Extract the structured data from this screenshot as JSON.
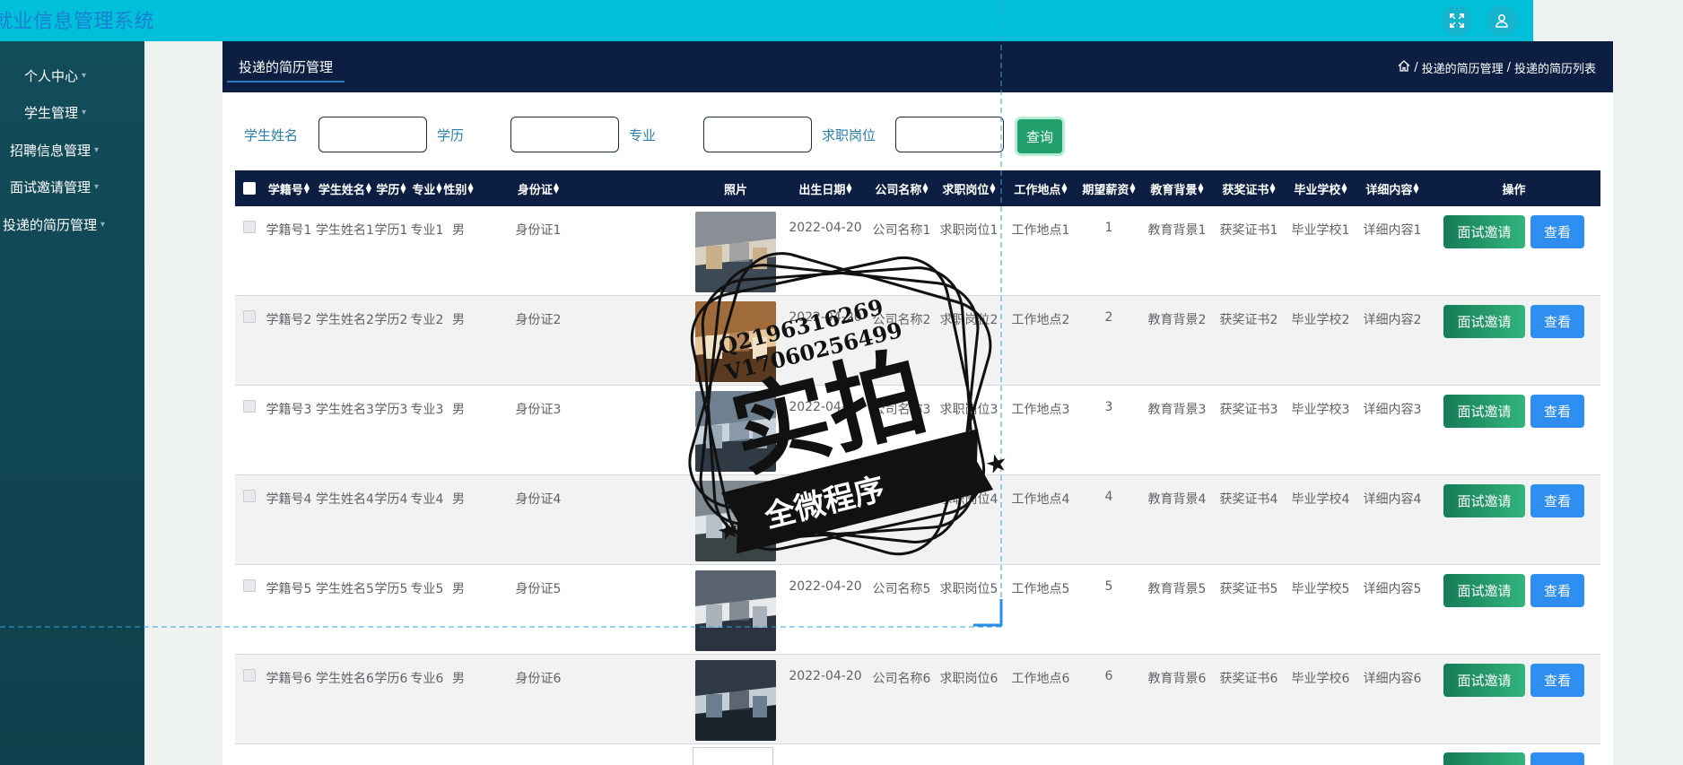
{
  "app": {
    "title": "就业信息管理系统"
  },
  "topbar": {
    "icons": [
      "fullscreen-icon",
      "user-icon"
    ]
  },
  "sidebar": {
    "items": [
      {
        "label": "个人中心"
      },
      {
        "label": "学生管理"
      },
      {
        "label": "招聘信息管理"
      },
      {
        "label": "面试邀请管理"
      },
      {
        "label": "投递的简历管理"
      }
    ]
  },
  "page": {
    "tab": "投递的简历管理",
    "breadcrumb": [
      "投递的简历管理",
      "投递的简历列表"
    ],
    "breadcrumb_sep": "/"
  },
  "search": {
    "labels": [
      "学生姓名",
      "学历",
      "专业",
      "求职岗位"
    ],
    "query_button": "查询"
  },
  "table": {
    "columns": [
      "学籍号",
      "学生姓名",
      "学历",
      "专业",
      "性别",
      "身份证",
      "照片",
      "出生日期",
      "公司名称",
      "求职岗位",
      "工作地点",
      "期望薪资",
      "教育背景",
      "获奖证书",
      "毕业学校",
      "详细内容",
      "操作"
    ],
    "rows": [
      [
        "学籍号1",
        "学生姓名1",
        "学历1",
        "专业1",
        "男",
        "身份证1",
        "",
        "2022-04-20",
        "公司名称1",
        "求职岗位1",
        "工作地点1",
        "1",
        "教育背景1",
        "获奖证书1",
        "毕业学校1",
        "详细内容1"
      ],
      [
        "学籍号2",
        "学生姓名2",
        "学历2",
        "专业2",
        "男",
        "身份证2",
        "",
        "2022-04-20",
        "公司名称2",
        "求职岗位2",
        "工作地点2",
        "2",
        "教育背景2",
        "获奖证书2",
        "毕业学校2",
        "详细内容2"
      ],
      [
        "学籍号3",
        "学生姓名3",
        "学历3",
        "专业3",
        "男",
        "身份证3",
        "",
        "2022-04-20",
        "公司名称3",
        "求职岗位3",
        "工作地点3",
        "3",
        "教育背景3",
        "获奖证书3",
        "毕业学校3",
        "详细内容3"
      ],
      [
        "学籍号4",
        "学生姓名4",
        "学历4",
        "专业4",
        "男",
        "身份证4",
        "",
        "2022-04-20",
        "公司名称4",
        "求职岗位4",
        "工作地点4",
        "4",
        "教育背景4",
        "获奖证书4",
        "毕业学校4",
        "详细内容4"
      ],
      [
        "学籍号5",
        "学生姓名5",
        "学历5",
        "专业5",
        "男",
        "身份证5",
        "",
        "2022-04-20",
        "公司名称5",
        "求职岗位5",
        "工作地点5",
        "5",
        "教育背景5",
        "获奖证书5",
        "毕业学校5",
        "详细内容5"
      ],
      [
        "学籍号6",
        "学生姓名6",
        "学历6",
        "专业6",
        "男",
        "身份证6",
        "",
        "2022-04-20",
        "公司名称6",
        "求职岗位6",
        "工作地点6",
        "6",
        "教育背景6",
        "获奖证书6",
        "毕业学校6",
        "详细内容6"
      ]
    ],
    "actions": {
      "invite": "面试邀请",
      "view": "查看"
    }
  },
  "watermark": {
    "line1": "Q2196316269",
    "line2": "V17060256499",
    "main": "实拍",
    "ribbon": "全微程序"
  },
  "colors": {
    "topbar": "#00c0d9",
    "sidebar": "#124d5a",
    "header": "#0c1f42",
    "invite": "#21a06d",
    "view": "#2f8ff0"
  }
}
